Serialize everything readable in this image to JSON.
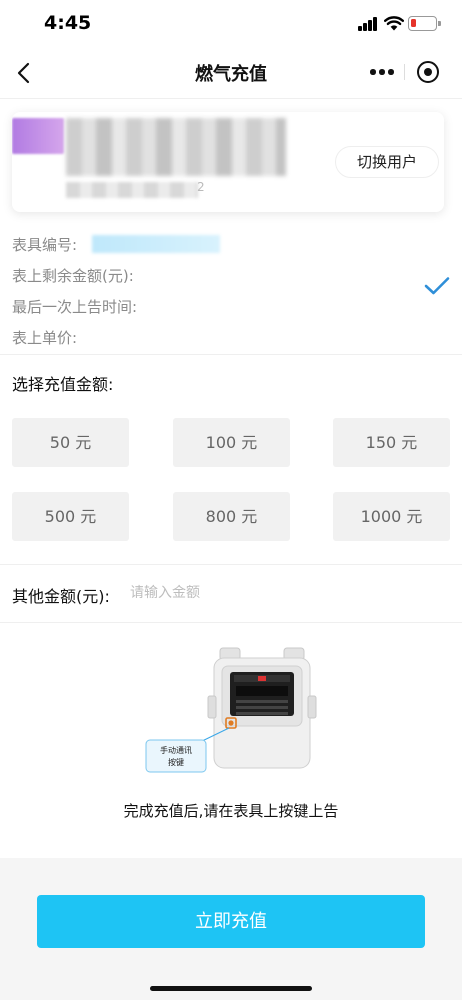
{
  "status_bar": {
    "time": "4:45",
    "battery_color": "#e5332a"
  },
  "nav": {
    "title": "燃气充值",
    "back_icon": "chevron-left-icon",
    "more_icon": "more-dots-icon",
    "close_icon": "close-miniprogram-icon"
  },
  "user_card": {
    "address_tail": "2",
    "switch_button": "切换用户"
  },
  "meter_info": {
    "meter_id_label": "表具编号:",
    "remaining_label": "表上剩余金额(元):",
    "last_report_label": "最后一次上告时间:",
    "unit_price_label": "表上单价:"
  },
  "recharge": {
    "select_label": "选择充值金额:",
    "amounts": [
      "50 元",
      "100 元",
      "150 元",
      "500 元",
      "800 元",
      "1000 元"
    ],
    "other_label": "其他金额(元):",
    "other_placeholder": "请输入金额",
    "other_value": ""
  },
  "illustration": {
    "callout_text_1": "手动通讯",
    "callout_text_2": "按键"
  },
  "caption": "完成充值后,请在表具上按键上告",
  "action": {
    "recharge_button": "立即充值"
  },
  "colors": {
    "accent": "#1ec4f4",
    "check": "#2f8fd8"
  }
}
